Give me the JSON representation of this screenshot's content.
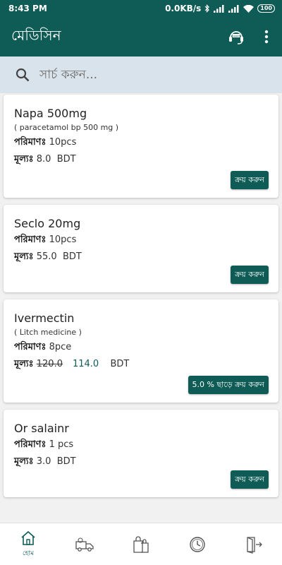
{
  "status": {
    "time": "8:43 PM",
    "speed": "0.0KB/s",
    "battery": "100"
  },
  "app": {
    "title": "মেডিসিন",
    "support_label": "Support"
  },
  "search": {
    "placeholder": "সার্চ করুন..."
  },
  "labels": {
    "quantity": "পরিমাণঃ",
    "price": "মূল্যঃ",
    "currency": "BDT"
  },
  "medicines": [
    {
      "name": "Napa 500mg",
      "generic": "( paracetamol bp 500 mg )",
      "quantity": "10pcs",
      "price": "8.0",
      "button": "ক্রয় করুন"
    },
    {
      "name": "Seclo 20mg",
      "quantity": "10pcs",
      "price": "55.0",
      "button": "ক্রয় করুন"
    },
    {
      "name": "Ivermectin",
      "generic": "( Litch medicine )",
      "quantity": "8pce",
      "old_price": "120.0",
      "price": "114.0",
      "button": "5.0 % ছাড়ে ক্রয় করুন"
    },
    {
      "name": "Or salainr",
      "quantity": "1 pcs",
      "price": "3.0",
      "button": "ক্রয় করুন"
    }
  ],
  "nav": {
    "home_label": "হোম"
  },
  "colors": {
    "primary": "#0f5c56",
    "search_bg": "#d8e3eb"
  }
}
